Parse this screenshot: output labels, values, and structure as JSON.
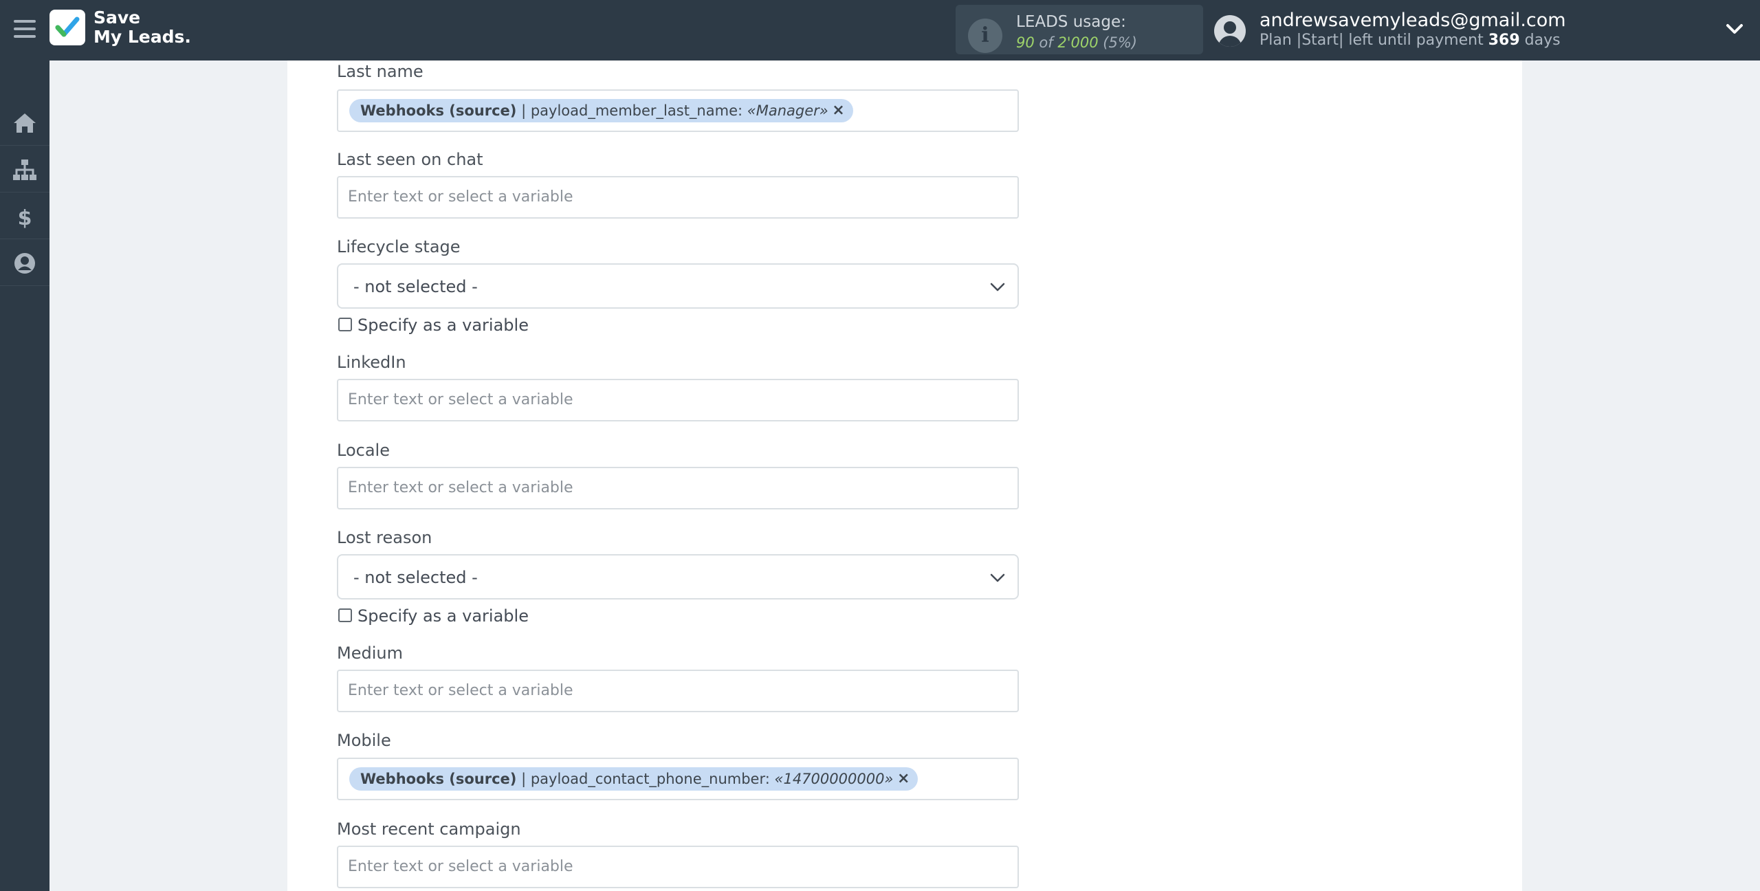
{
  "app": {
    "logo_line1": "Save",
    "logo_line2": "My Leads."
  },
  "usage": {
    "title": "LEADS usage:",
    "used": "90",
    "of": "of",
    "total": "2'000",
    "percent": "(5%)"
  },
  "user": {
    "email": "andrewsavemyleads@gmail.com",
    "plan_prefix": "Plan |Start| left until payment",
    "days": "369",
    "days_suffix": "days"
  },
  "sidebar": {
    "items": [
      {
        "icon": "home-icon"
      },
      {
        "icon": "sitemap-icon"
      },
      {
        "icon": "dollar-icon"
      },
      {
        "icon": "user-circle-icon"
      }
    ]
  },
  "colors": {
    "sidebar": "#2d3a46",
    "tag": "#c8dcf4",
    "usage_green": "#9ed36a"
  },
  "fields": {
    "last_name": {
      "label": "Last name",
      "tag_source": "Webhooks (source)",
      "tag_field": "| payload_member_last_name:",
      "tag_value": "«Manager»",
      "tag_remove": "×"
    },
    "last_seen": {
      "label": "Last seen on chat",
      "placeholder": "Enter text or select a variable"
    },
    "lifecycle": {
      "label": "Lifecycle stage",
      "value": "- not selected -",
      "checkbox": "Specify as a variable"
    },
    "linkedin": {
      "label": "LinkedIn",
      "placeholder": "Enter text or select a variable"
    },
    "locale": {
      "label": "Locale",
      "placeholder": "Enter text or select a variable"
    },
    "lost_reason": {
      "label": "Lost reason",
      "value": "- not selected -",
      "checkbox": "Specify as a variable"
    },
    "medium": {
      "label": "Medium",
      "placeholder": "Enter text or select a variable"
    },
    "mobile": {
      "label": "Mobile",
      "tag_source": "Webhooks (source)",
      "tag_field": "| payload_contact_phone_number:",
      "tag_value": "«14700000000»",
      "tag_remove": "×"
    },
    "campaign": {
      "label": "Most recent campaign",
      "placeholder": "Enter text or select a variable"
    }
  }
}
